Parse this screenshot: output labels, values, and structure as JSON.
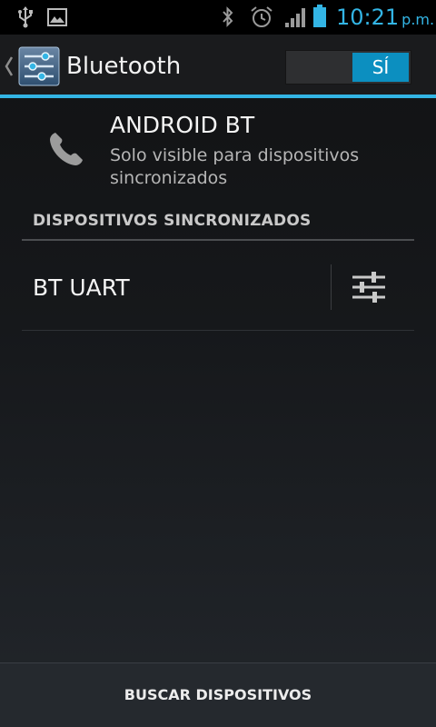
{
  "status_bar": {
    "time": "10:21",
    "ampm": "p.m.",
    "icons": [
      "usb-icon",
      "image-icon",
      "bluetooth-icon",
      "alarm-icon",
      "signal-icon",
      "battery-icon"
    ],
    "accent_color": "#33b5e5"
  },
  "action_bar": {
    "title": "Bluetooth",
    "toggle_label": "SÍ",
    "toggle_state": "on",
    "icons": [
      "back-caret-icon",
      "settings-sliders-icon"
    ]
  },
  "local_device": {
    "name": "ANDROID BT",
    "visibility": "Solo visible para dispositivos sincronizados",
    "icon": "phone-icon"
  },
  "paired_section": {
    "header": "DISPOSITIVOS SINCRONIZADOS",
    "devices": [
      {
        "name": "BT UART",
        "action_icon": "settings-sliders-icon"
      }
    ]
  },
  "bottom_bar": {
    "button_label": "BUSCAR DISPOSITIVOS"
  }
}
